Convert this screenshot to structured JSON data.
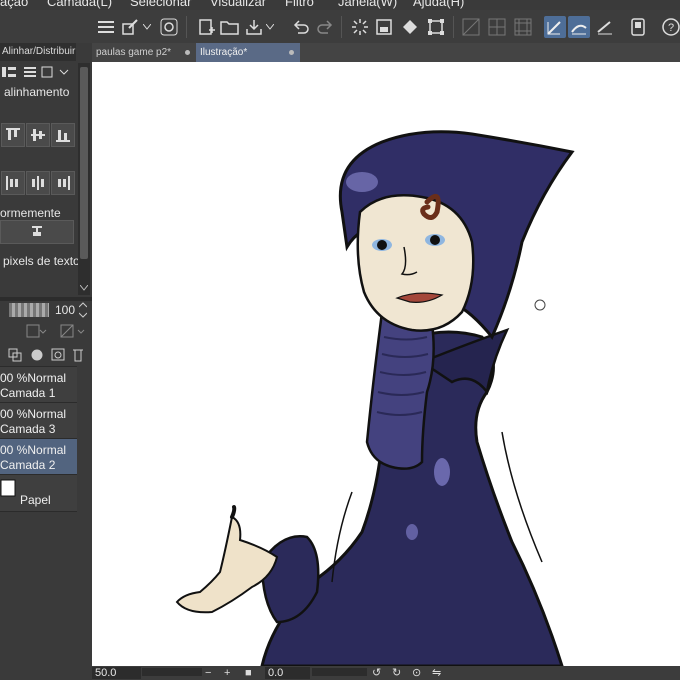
{
  "menu": [
    "ação",
    "Camada(L)",
    "Selecionar",
    "Visualizar",
    "Filtro",
    "Janela(W)",
    "Ajuda(H)"
  ],
  "toolbar_icons": [
    "menu-icon",
    "brush-icon",
    "chevron-down-icon",
    "swirl-icon",
    "new-file-icon",
    "open-folder-icon",
    "save-icon",
    "chevron-down-icon",
    "undo-icon",
    "redo-icon",
    "sparkle-icon",
    "fill-icon",
    "transform-icon",
    "grid-icon",
    "ruler-icon",
    "guide-icon",
    "snap-to-ruler-icon",
    "snap-special-icon",
    "snap-grid-icon",
    "tablet-icon",
    "help-icon"
  ],
  "tabs": [
    {
      "label": "paulas game p2*"
    },
    {
      "label": "Ilustração*"
    }
  ],
  "left_panel": {
    "header": "Alinhar/Distribuir",
    "section1": "alinhamento",
    "section2": "ormemente",
    "section3": "pixels de texto",
    "opacity_value": "100",
    "paper_label": "Papel"
  },
  "layers": [
    {
      "percent": "00 %",
      "mode": "Normal",
      "name": "Camada 1",
      "selected": false
    },
    {
      "percent": "00 %",
      "mode": "Normal",
      "name": "Camada 3",
      "selected": false
    },
    {
      "percent": "00 %",
      "mode": "Normal",
      "name": "Camada 2",
      "selected": true
    }
  ],
  "status": {
    "zoom": "50.0",
    "rotation": "0.0"
  },
  "colors": {
    "accent": "#4e6e98",
    "canvas": "#ffffff",
    "robe": "#2b2a5a"
  }
}
